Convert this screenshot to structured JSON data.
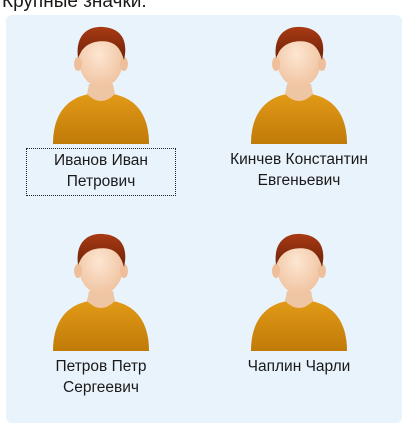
{
  "heading": "Крупные значки:",
  "people": [
    {
      "line1": "Иванов Иван",
      "line2": "Петрович",
      "selected": true
    },
    {
      "line1": "Кинчев Константин",
      "line2": "Евгеньевич",
      "selected": false
    },
    {
      "line1": "Петров Петр",
      "line2": "Сергеевич",
      "selected": false
    },
    {
      "line1": "Чаплин Чарли",
      "line2": "",
      "selected": false
    }
  ],
  "colors": {
    "panel_bg": "#e9f3fc",
    "shirt": "#d38b0f",
    "hair": "#8b2e10",
    "skin": "#f6d3b4"
  },
  "icons": [
    "user-avatar-icon"
  ]
}
